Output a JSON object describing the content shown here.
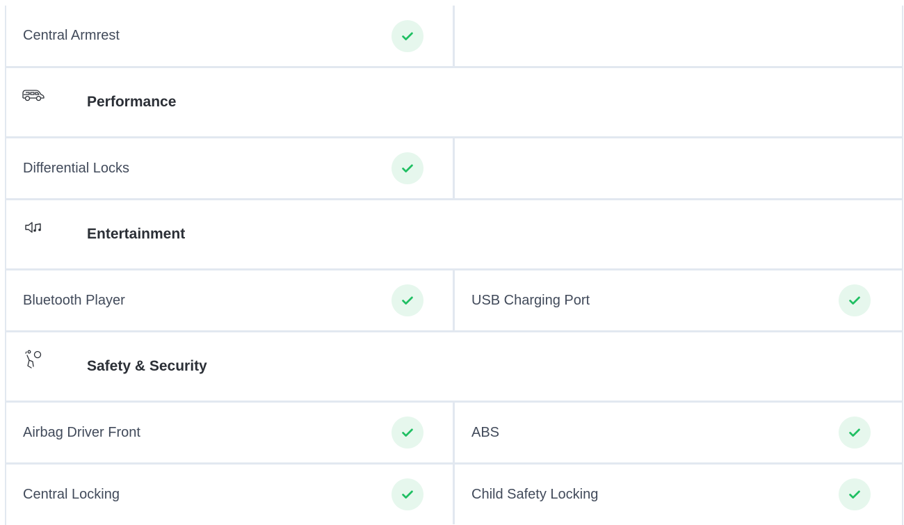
{
  "colors": {
    "check_bg": "#e6f7ed",
    "check_mark": "#1fbf62",
    "border": "#e2e8f0"
  },
  "rows": [
    {
      "kind": "features",
      "left": {
        "label": "Central Armrest",
        "available": true
      },
      "right": null
    },
    {
      "kind": "section",
      "icon": "car-icon",
      "title": "Performance"
    },
    {
      "kind": "features",
      "left": {
        "label": "Differential Locks",
        "available": true
      },
      "right": null
    },
    {
      "kind": "section",
      "icon": "speaker-music-icon",
      "title": "Entertainment"
    },
    {
      "kind": "features",
      "left": {
        "label": "Bluetooth Player",
        "available": true
      },
      "right": {
        "label": "USB Charging Port",
        "available": true
      }
    },
    {
      "kind": "section",
      "icon": "airbag-icon",
      "title": "Safety & Security"
    },
    {
      "kind": "features",
      "left": {
        "label": "Airbag Driver Front",
        "available": true
      },
      "right": {
        "label": "ABS",
        "available": true
      }
    },
    {
      "kind": "features",
      "left": {
        "label": "Central Locking",
        "available": true
      },
      "right": {
        "label": "Child Safety Locking",
        "available": true
      }
    }
  ]
}
